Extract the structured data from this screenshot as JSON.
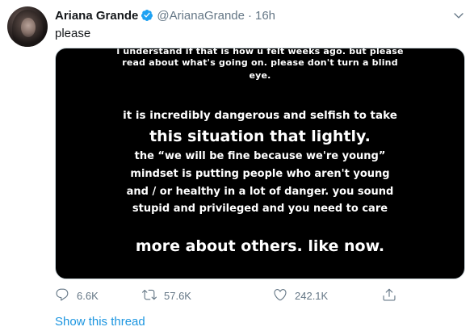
{
  "tweet": {
    "author": {
      "display_name": "Ariana Grande",
      "handle": "@ArianaGrande",
      "verified": true,
      "verified_icon": "verified-badge-icon"
    },
    "separator": "·",
    "time": "16h",
    "text": "please",
    "menu_icon": "chevron-down-icon",
    "media": {
      "lines": [
        "i understand if that is how u felt weeks ago. but please",
        "read about what's going on. please don't turn a blind",
        "eye.",
        "it is incredibly dangerous and selfish to take",
        "this situation that lightly.",
        "the “we will be fine because we're young”",
        "mindset is putting people who aren't young",
        "and / or healthy in a lot of danger. you sound",
        "stupid and privileged and you need to care",
        "more about others. like now."
      ]
    },
    "actions": {
      "reply": {
        "icon": "reply-icon",
        "count": "6.6K"
      },
      "retweet": {
        "icon": "retweet-icon",
        "count": "57.6K"
      },
      "like": {
        "icon": "heart-icon",
        "count": "242.1K"
      },
      "share": {
        "icon": "share-icon"
      }
    },
    "show_thread": "Show this thread"
  },
  "colors": {
    "text_primary": "#14171a",
    "text_secondary": "#657786",
    "link": "#1b95e0",
    "verified": "#1da1f2",
    "media_bg": "#000000"
  }
}
